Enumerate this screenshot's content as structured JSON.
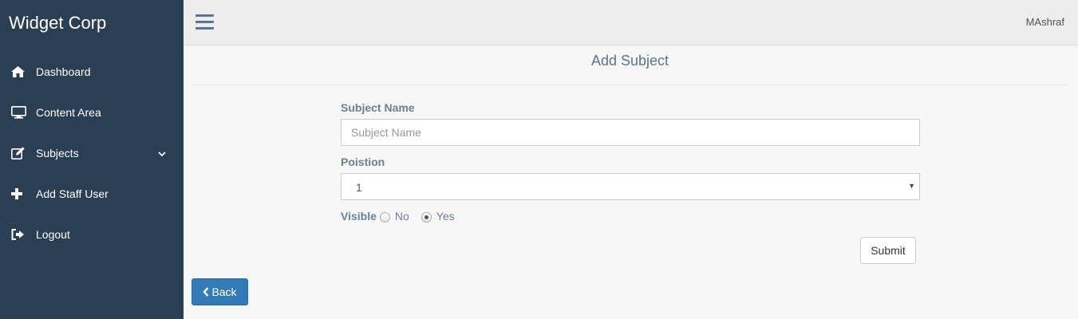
{
  "sidebar": {
    "brand": "Widget Corp",
    "items": [
      {
        "label": "Dashboard",
        "icon": "home-icon"
      },
      {
        "label": "Content Area",
        "icon": "monitor-icon"
      },
      {
        "label": "Subjects",
        "icon": "edit-icon",
        "has_submenu": true
      },
      {
        "label": "Add Staff User",
        "icon": "plus-icon"
      },
      {
        "label": "Logout",
        "icon": "sign-out-icon"
      }
    ]
  },
  "header": {
    "user": "MAshraf"
  },
  "page": {
    "title": "Add Subject"
  },
  "form": {
    "subject_name_label": "Subject Name",
    "subject_name_placeholder": "Subject Name",
    "subject_name_value": "",
    "position_label": "Poistion",
    "position_value": "1",
    "visible_label": "Visible",
    "visible_options": [
      "No",
      "Yes"
    ],
    "visible_selected": "Yes",
    "submit_label": "Submit"
  },
  "back_label": "Back",
  "colors": {
    "sidebar_bg": "#2a3f54",
    "accent_blue": "#337ab7",
    "title_color": "#5a738e"
  }
}
